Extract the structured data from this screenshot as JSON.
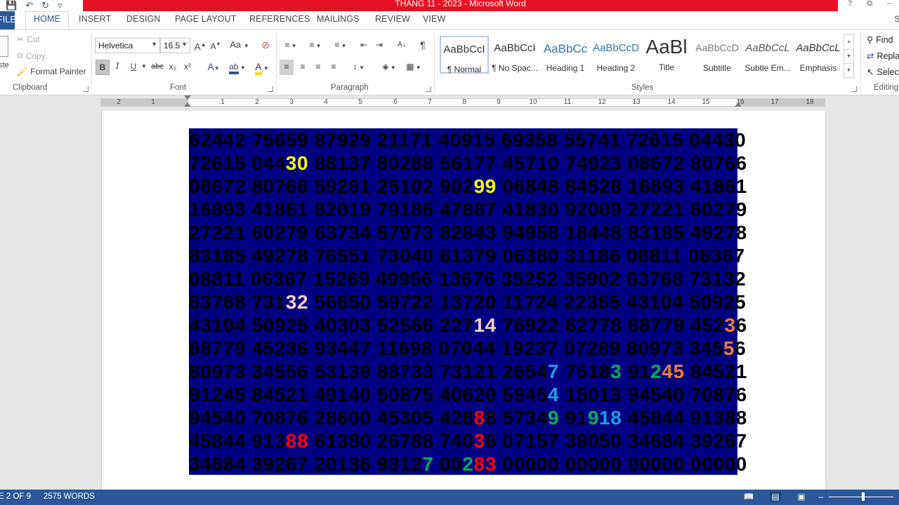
{
  "window": {
    "title": "THANG 11 - 2023 - Microsoft Word",
    "help": "?",
    "ribbon_display": "⧉",
    "minimize": "–"
  },
  "tabs": {
    "file": "FILE",
    "items": [
      "HOME",
      "INSERT",
      "DESIGN",
      "PAGE LAYOUT",
      "REFERENCES",
      "MAILINGS",
      "REVIEW",
      "VIEW"
    ],
    "active": "HOME",
    "signin": "Si"
  },
  "clipboard": {
    "cut": "Cut",
    "copy": "Copy",
    "format_painter": "Format Painter",
    "paste": "ste",
    "label": "Clipboard"
  },
  "font": {
    "family": "Helvetica",
    "size": "16.5",
    "grow": "A",
    "shrink": "A",
    "case": "Aa",
    "bold": "B",
    "italic": "I",
    "underline": "U",
    "strike": "abc",
    "subscript": "x₂",
    "superscript": "x²",
    "highlight": "ab",
    "color": "A",
    "label": "Font"
  },
  "paragraph": {
    "label": "Paragraph",
    "sort": "A↓",
    "pilcrow": "¶"
  },
  "styles": {
    "label": "Styles",
    "items": [
      {
        "preview": "AaBbCcI",
        "name": "¶ Normal"
      },
      {
        "preview": "AaBbCcI",
        "name": "¶ No Spac..."
      },
      {
        "preview": "AaBbCc",
        "name": "Heading 1"
      },
      {
        "preview": "AaBbCcD",
        "name": "Heading 2"
      },
      {
        "preview": "AaBl",
        "name": "Title"
      },
      {
        "preview": "AaBbCcD",
        "name": "Subtitle"
      },
      {
        "preview": "AaBbCcL",
        "name": "Subtle Em..."
      },
      {
        "preview": "AaBbCcL",
        "name": "Emphasis"
      }
    ]
  },
  "editing": {
    "find": "Find",
    "replace": "Repla",
    "select": "Select",
    "label": "Editing"
  },
  "ruler": {
    "numbers": [
      "2",
      "1",
      "1",
      "2",
      "3",
      "4",
      "5",
      "6",
      "7",
      "8",
      "9",
      "10",
      "11",
      "12",
      "13",
      "14",
      "15",
      "16",
      "17",
      "18"
    ]
  },
  "document": {
    "rows": [
      "62442 75659 87929 21171 40915 69358 55741 72615 04430",
      "72615 04430 88137 80288 56177 45710 74923 08672 80766",
      "08672 80766 59261 25102 90299 06848 84528 16893 41861",
      "16893 41861 82019 79186 47887 41830 92009 27221 60279",
      "27221 60279 63734 57973 82843 94958 18448 83185 49278",
      "83185 49278 76551 73040 61379 06380 31186 08811 06367",
      "08811 06367 15269 49956 13676 35252 35902 63768 73132",
      "63768 73132 56650 59722 13720 11724 22365 43104 50925",
      "43104 50925 40303 52566 22714 76922 62778 68779 45236",
      "68779 45236 93447 11698 07044 19237 07289 80973 34556",
      "80973 34556 53139 88733 73121 26547 75183 91245 84521",
      "91245 84521 49140 50875 40620 59454 15013 94540 70876",
      "94540 70876 28600 45305 42888 57349 91918 45844 91388",
      "45844 91388 61380 26788 74036 07157 38050 34684 39267",
      "34684 39267 20136 93127 00283 00000 00000 00000 00000"
    ],
    "highlights": [
      {
        "row": 1,
        "col": 9,
        "len": 2,
        "color": "#ffff00"
      },
      {
        "row": 2,
        "col": 27,
        "len": 2,
        "color": "#ffff00"
      },
      {
        "row": 7,
        "col": 9,
        "len": 2,
        "color": "#f4cccc"
      },
      {
        "row": 8,
        "col": 27,
        "len": 2,
        "color": "#f4cccc"
      },
      {
        "row": 8,
        "col": 51,
        "len": 1,
        "color": "#ed7d31"
      },
      {
        "row": 9,
        "col": 51,
        "len": 1,
        "color": "#ed7d31"
      },
      {
        "row": 10,
        "col": 34,
        "len": 1,
        "color": "#1e9be8"
      },
      {
        "row": 10,
        "col": 40,
        "len": 1,
        "color": "#00b050"
      },
      {
        "row": 10,
        "col": 44,
        "len": 1,
        "color": "#00b050"
      },
      {
        "row": 10,
        "col": 45,
        "len": 2,
        "color": "#ed7d31"
      },
      {
        "row": 11,
        "col": 34,
        "len": 1,
        "color": "#1e9be8"
      },
      {
        "row": 12,
        "col": 27,
        "len": 1,
        "color": "#ff0000"
      },
      {
        "row": 12,
        "col": 34,
        "len": 1,
        "color": "#00b050"
      },
      {
        "row": 12,
        "col": 38,
        "len": 1,
        "color": "#00b050"
      },
      {
        "row": 12,
        "col": 39,
        "len": 2,
        "color": "#1e9be8"
      },
      {
        "row": 13,
        "col": 9,
        "len": 2,
        "color": "#ff0000"
      },
      {
        "row": 13,
        "col": 27,
        "len": 1,
        "color": "#ff0000"
      },
      {
        "row": 14,
        "col": 22,
        "len": 1,
        "color": "#00b050"
      },
      {
        "row": 14,
        "col": 26,
        "len": 1,
        "color": "#00b050"
      },
      {
        "row": 14,
        "col": 27,
        "len": 2,
        "color": "#ff0000"
      }
    ]
  },
  "status": {
    "page": "E 2 OF 9",
    "words": "2575 WORDS"
  },
  "colors": {
    "accent": "#2b579a",
    "title_bar": "#e81123",
    "doc_bg": "#000080"
  }
}
